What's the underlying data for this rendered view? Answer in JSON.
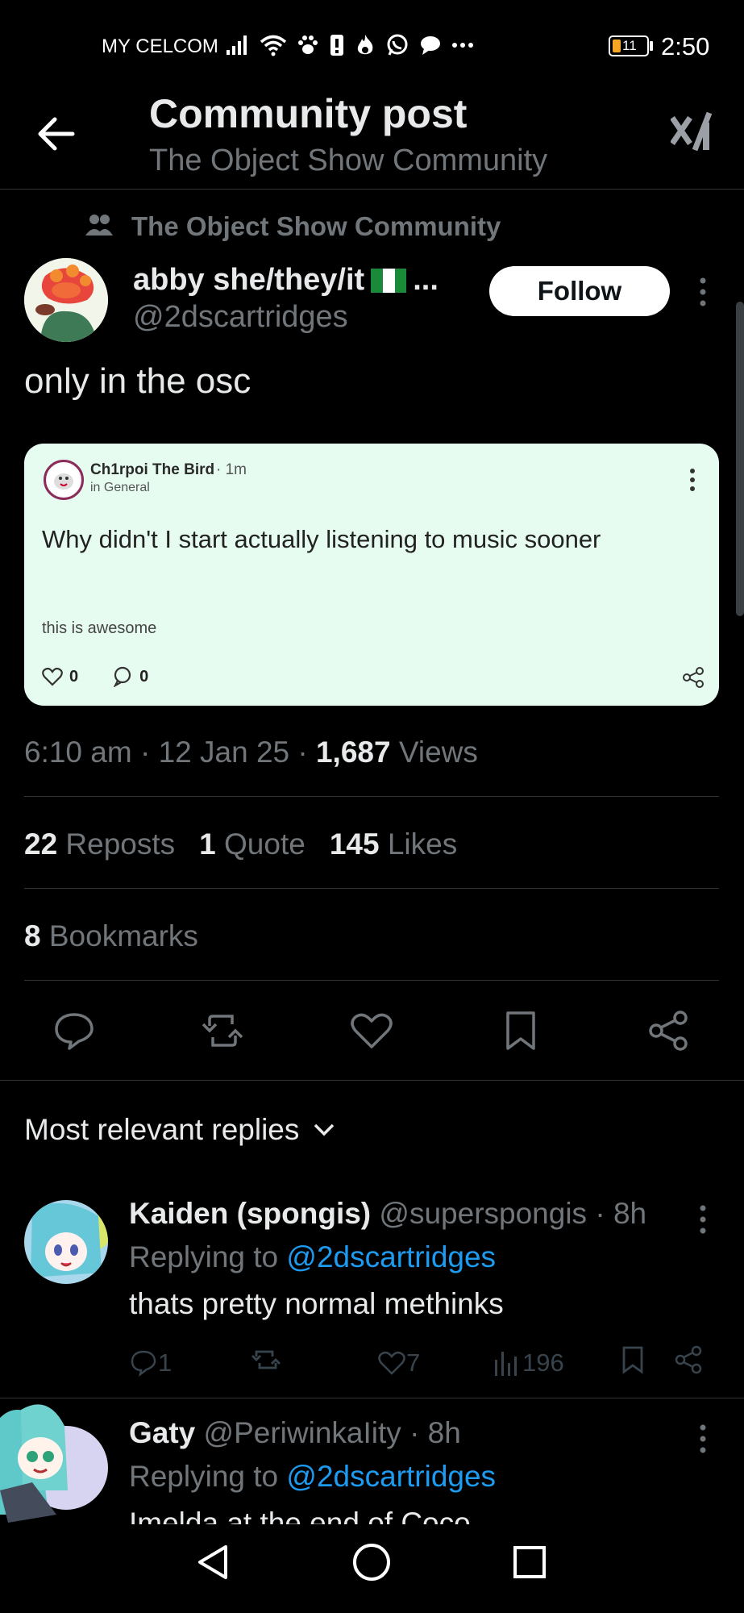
{
  "status_bar": {
    "carrier": "MY CELCOM",
    "battery": "11",
    "time": "2:50",
    "icons": [
      "signal-icon",
      "wifi-icon",
      "paw-icon",
      "alert-icon",
      "flame-icon",
      "whatsapp-icon",
      "chat-bubble-icon",
      "more-notifications-icon"
    ]
  },
  "header": {
    "title": "Community post",
    "subtitle": "The Object Show Community"
  },
  "post": {
    "community": "The Object Show Community",
    "author_name": "abby she/they/it",
    "author_name_suffix": "...",
    "author_handle": "@2dscartridges",
    "follow_label": "Follow",
    "text": "only in the osc",
    "time": "6:10 am · 12 Jan 25 · ",
    "views_count": "1,687",
    "views_label": " Views",
    "reposts_count": "22",
    "reposts_label": " Reposts",
    "quotes_count": "1",
    "quotes_label": " Quote",
    "likes_count": "145",
    "likes_label": " Likes",
    "bookmarks_count": "8",
    "bookmarks_label": " Bookmarks"
  },
  "embed": {
    "author": "Ch1rpoi The Bird",
    "time": "· 1m",
    "sub": "in General",
    "title": "Why didn't I start actually listening to music sooner",
    "body": "this is awesome",
    "likes": "0",
    "comments": "0"
  },
  "replies_header": "Most relevant replies",
  "replies": [
    {
      "name": "Kaiden (spongis)",
      "handle": "@superspongis",
      "time": "· 8h",
      "replying_label": "Replying to ",
      "replying_to": "@2dscartridges",
      "text": "thats pretty normal methinks",
      "comments": "1",
      "likes": "7",
      "views": "196"
    },
    {
      "name": "Gaty",
      "handle": "@PeriwinkaIity",
      "time": "· 8h",
      "replying_label": "Replying to ",
      "replying_to": "@2dscartridges",
      "text": "Imelda at the end of Coco"
    }
  ]
}
